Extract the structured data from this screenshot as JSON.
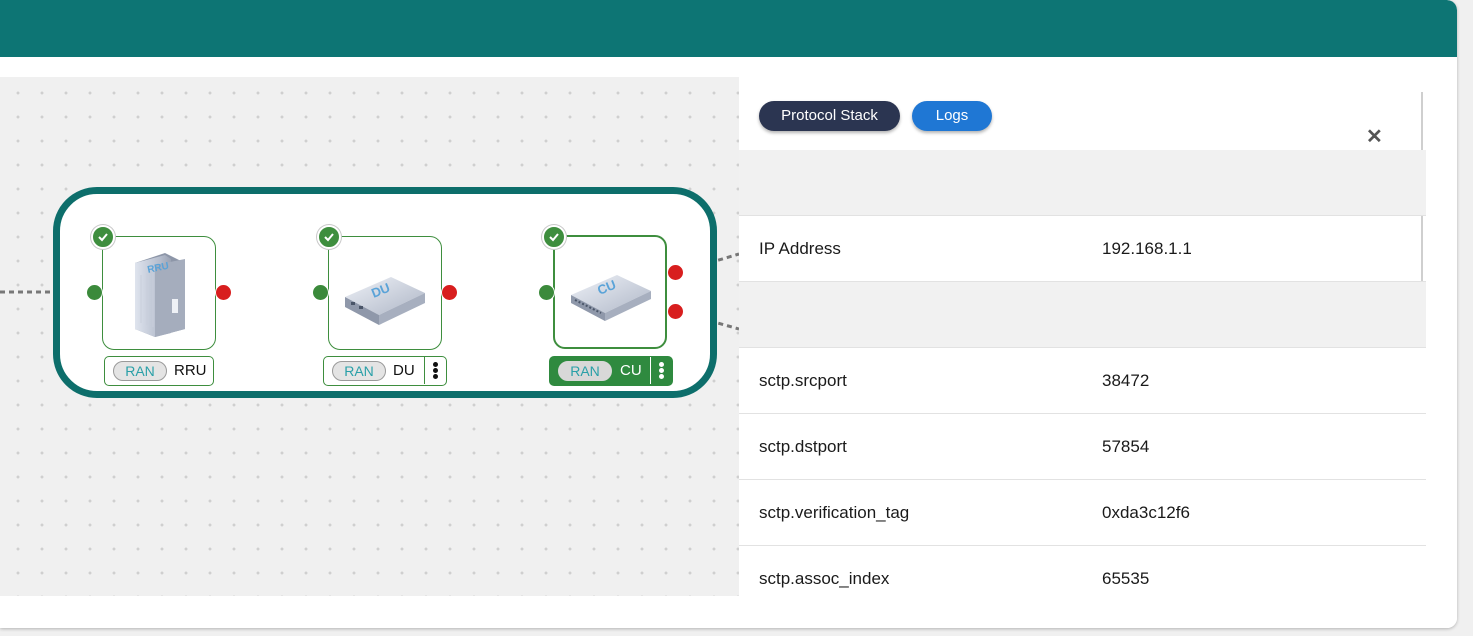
{
  "panel": {
    "tabs": [
      {
        "label": "Protocol Stack",
        "color": "#2b3551"
      },
      {
        "label": "Logs",
        "color": "#1f77d4"
      }
    ],
    "close_icon": "close-icon",
    "rows": [
      {
        "type": "header",
        "key": "",
        "value": ""
      },
      {
        "type": "field",
        "key": "IP Address",
        "value": "192.168.1.1"
      },
      {
        "type": "header",
        "key": "",
        "value": ""
      },
      {
        "type": "field",
        "key": "sctp.srcport",
        "value": "38472"
      },
      {
        "type": "field",
        "key": "sctp.dstport",
        "value": "57854"
      },
      {
        "type": "field",
        "key": "sctp.verification_tag",
        "value": "0xda3c12f6"
      },
      {
        "type": "field",
        "key": "sctp.assoc_index",
        "value": "65535"
      }
    ]
  },
  "topology": {
    "group_color": "#0d6e6b",
    "nodes": [
      {
        "id": "rru",
        "badge": "RAN",
        "name": "RRU",
        "icon_text": "RRU",
        "status": "ok",
        "selected": false,
        "menu": false
      },
      {
        "id": "du",
        "badge": "RAN",
        "name": "DU",
        "icon_text": "DU",
        "status": "ok",
        "selected": false,
        "menu": true
      },
      {
        "id": "cu",
        "badge": "RAN",
        "name": "CU",
        "icon_text": "CU",
        "status": "ok",
        "selected": true,
        "menu": true
      }
    ]
  },
  "colors": {
    "header": "#0d7574",
    "port_ok": "#3b8a3b",
    "port_down": "#d81e1e",
    "status_ok": "#3e8e3e"
  }
}
